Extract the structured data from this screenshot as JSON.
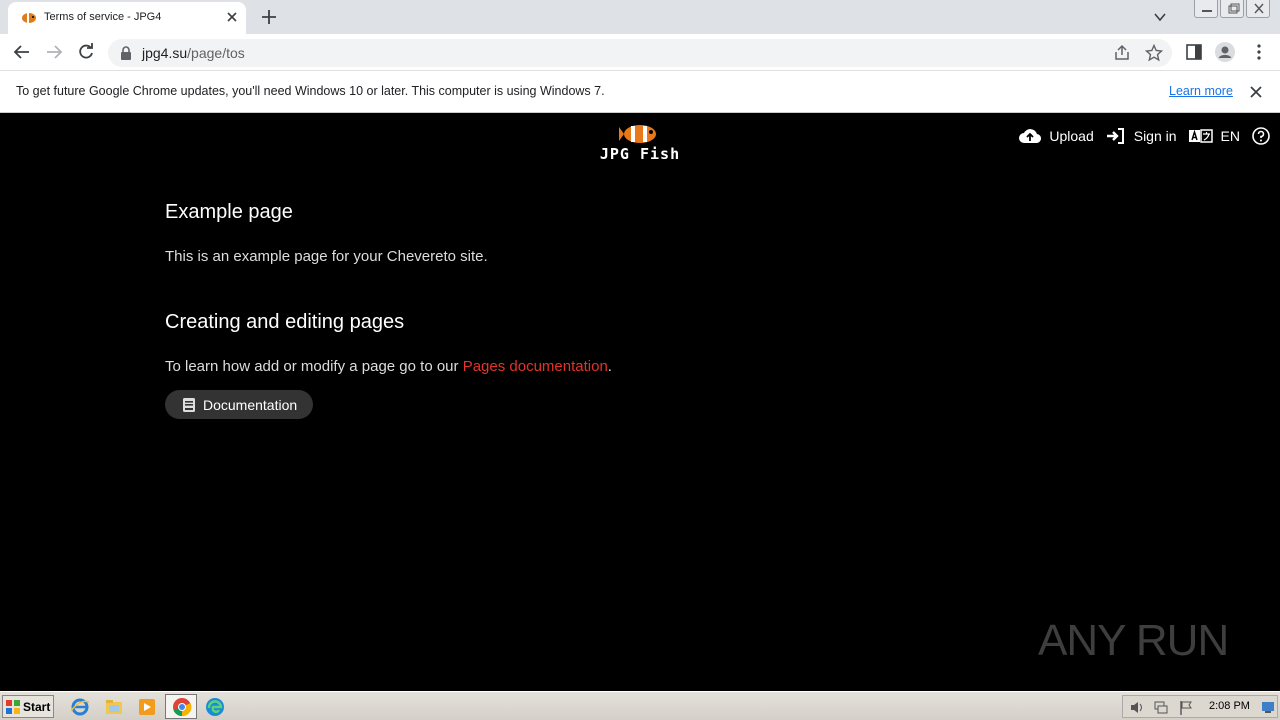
{
  "browser": {
    "tab_title": "Terms of service - JPG4",
    "url_domain": "jpg4.su",
    "url_path": "/page/tos",
    "infobar_text": "To get future Google Chrome updates, you'll need Windows 10 or later. This computer is using Windows 7.",
    "infobar_link": "Learn more"
  },
  "site": {
    "logo_text": "JPG Fish",
    "nav": {
      "upload": "Upload",
      "sign_in": "Sign in",
      "language": "EN"
    }
  },
  "content": {
    "heading1": "Example page",
    "para1": "This is an example page for your Chevereto site.",
    "heading2": "Creating and editing pages",
    "para2_prefix": "To learn how add or modify a page go to our ",
    "para2_link": "Pages documentation",
    "para2_suffix": ".",
    "doc_button": "Documentation"
  },
  "watermark": "ANY RUN",
  "taskbar": {
    "start_label": "Start",
    "clock": "2:08 PM"
  },
  "colors": {
    "link_red": "#e0342b",
    "chrome_blue": "#1a73e8"
  }
}
